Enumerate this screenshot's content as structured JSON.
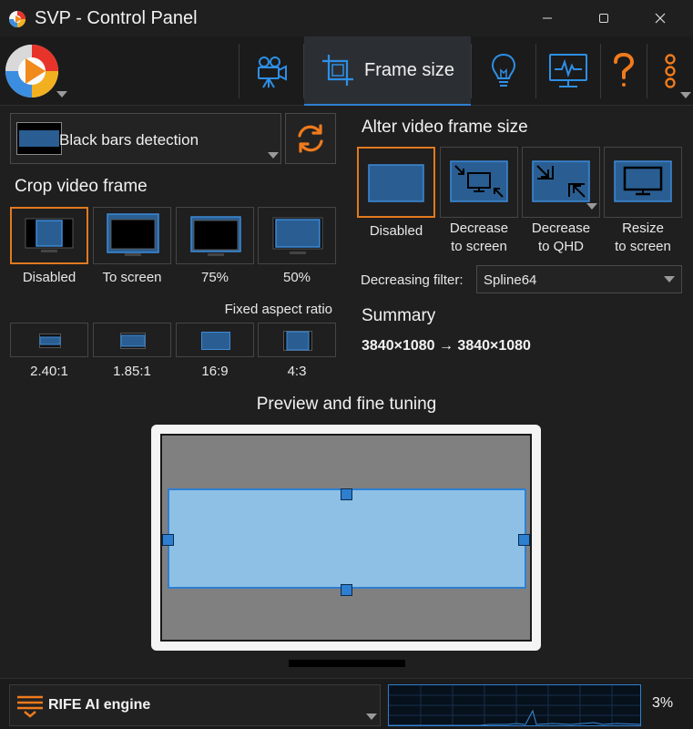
{
  "window": {
    "title": "SVP - Control Panel",
    "minimize_icon": "minimize-icon",
    "maximize_icon": "maximize-icon",
    "close_icon": "close-icon"
  },
  "toolbar": {
    "tabs": [
      {
        "icon": "movie-camera-icon",
        "label": ""
      },
      {
        "icon": "crop-icon",
        "label": "Frame size",
        "active": true
      },
      {
        "icon": "lightbulb-icon",
        "label": ""
      },
      {
        "icon": "monitor-icon",
        "label": ""
      },
      {
        "icon": "question-icon",
        "label": ""
      },
      {
        "icon": "more-icon",
        "label": ""
      }
    ]
  },
  "black_bars": {
    "label": "Black bars detection"
  },
  "crop": {
    "title": "Crop video frame",
    "options": [
      {
        "label": "Disabled",
        "selected": true
      },
      {
        "label": "To screen"
      },
      {
        "label": "75%"
      },
      {
        "label": "50%"
      }
    ],
    "fixed_aspect_label": "Fixed aspect ratio",
    "aspects": [
      {
        "label": "2.40:1"
      },
      {
        "label": "1.85:1"
      },
      {
        "label": "16:9"
      },
      {
        "label": "4:3"
      }
    ]
  },
  "alter": {
    "title": "Alter video frame size",
    "options": [
      {
        "label": "Disabled",
        "selected": true
      },
      {
        "label_line1": "Decrease",
        "label_line2": "to screen"
      },
      {
        "label_line1": "Decrease",
        "label_line2": "to QHD"
      },
      {
        "label_line1": "Resize",
        "label_line2": "to screen"
      }
    ],
    "filter_label": "Decreasing filter:",
    "filter_value": "Spline64"
  },
  "summary": {
    "title": "Summary",
    "value": "3840×1080 → 3840×1080"
  },
  "preview": {
    "title": "Preview and fine tuning"
  },
  "bottom": {
    "engine_label": "RIFE AI engine",
    "cpu_percent": "3%"
  },
  "colors": {
    "accent_orange": "#e07a1f",
    "accent_blue": "#2e7fd0",
    "screen_blue": "#2a5e92",
    "crop_fill": "#8ec0e6"
  }
}
